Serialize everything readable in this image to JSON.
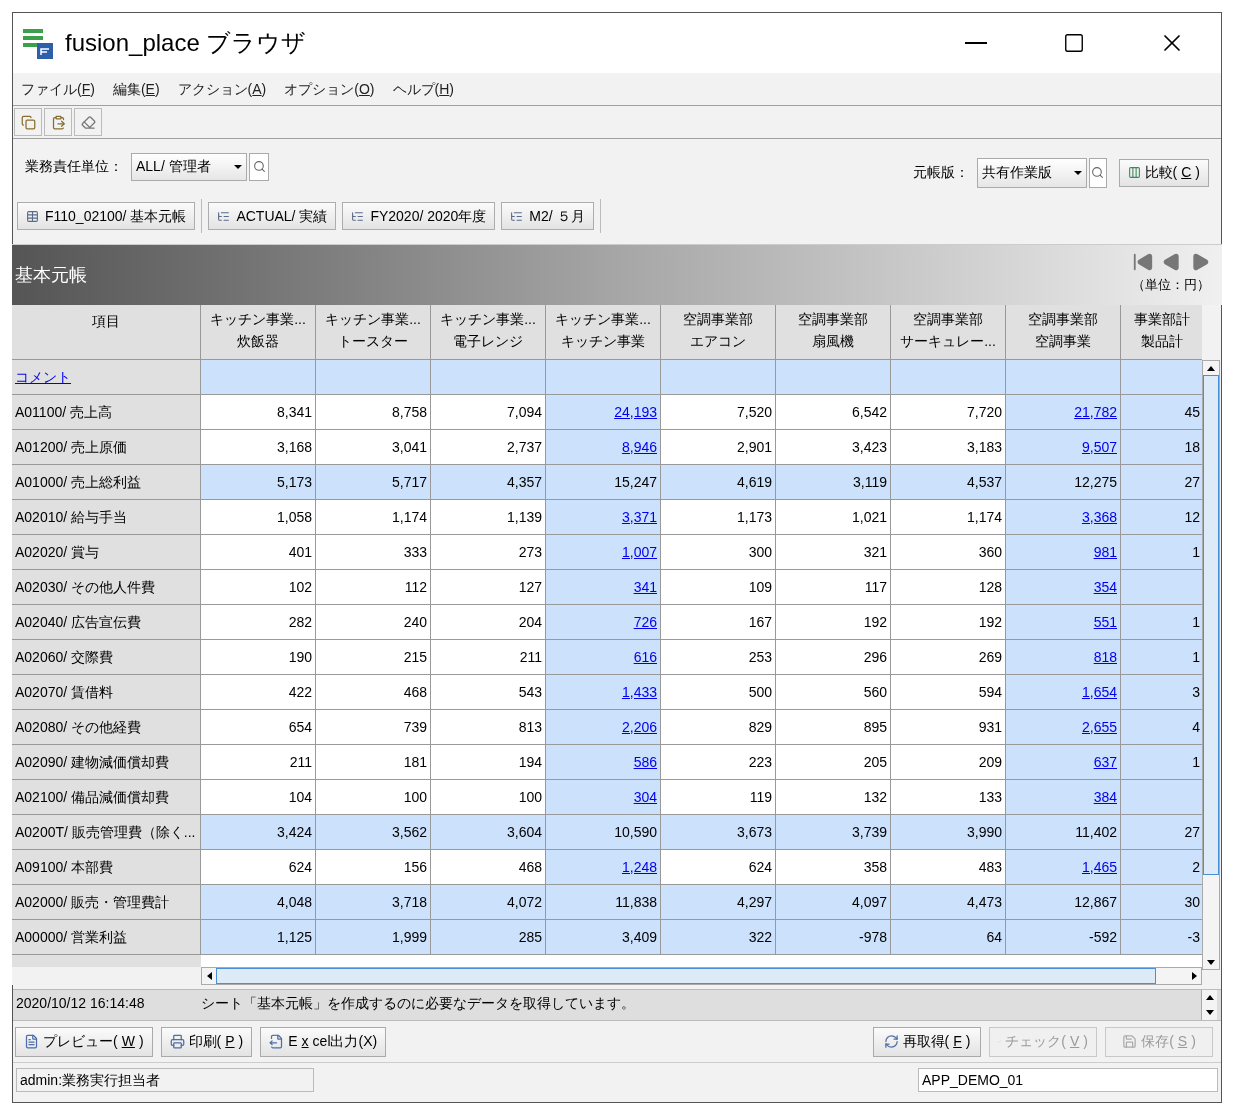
{
  "window": {
    "title": "fusion_place ブラウザ"
  },
  "menu": [
    {
      "before": "ファイル(",
      "key": "F",
      "after": ")"
    },
    {
      "before": "編集(",
      "key": "E",
      "after": ")"
    },
    {
      "before": "アクション(",
      "key": "A",
      "after": ")"
    },
    {
      "before": "オプション(",
      "key": "O",
      "after": ")"
    },
    {
      "before": "ヘルプ(",
      "key": "H",
      "after": ")"
    }
  ],
  "filters": {
    "unit": {
      "label": "業務責任単位：",
      "value": "ALL/ 管理者"
    },
    "version": {
      "label": "元帳版：",
      "value": "共有作業版"
    },
    "compare": {
      "before": "比較(",
      "key": "C",
      "after": ")"
    }
  },
  "chips": [
    {
      "kind": "sheet",
      "label": "F110_02100/ 基本元帳"
    },
    {
      "kind": "dimension",
      "label": "ACTUAL/ 実績"
    },
    {
      "kind": "dimension",
      "label": "FY2020/ 2020年度"
    },
    {
      "kind": "dimension",
      "label": "M2/ ５月"
    }
  ],
  "sheet": {
    "title": "基本元帳",
    "unit": "（単位：円）"
  },
  "table": {
    "corner": "項目",
    "comment": "コメント",
    "columns": [
      {
        "line1": "キッチン事業...",
        "line2": "炊飯器",
        "kind": "item"
      },
      {
        "line1": "キッチン事業...",
        "line2": "トースター",
        "kind": "item"
      },
      {
        "line1": "キッチン事業...",
        "line2": "電子レンジ",
        "kind": "item"
      },
      {
        "line1": "キッチン事業...",
        "line2": "キッチン事業",
        "kind": "subtotal"
      },
      {
        "line1": "空調事業部",
        "line2": "エアコン",
        "kind": "item"
      },
      {
        "line1": "空調事業部",
        "line2": "扇風機",
        "kind": "item"
      },
      {
        "line1": "空調事業部",
        "line2": "サーキュレー...",
        "kind": "item"
      },
      {
        "line1": "空調事業部",
        "line2": "空調事業",
        "kind": "subtotal"
      },
      {
        "line1": "事業部計",
        "line2": "製品計",
        "kind": "total"
      }
    ],
    "rows": [
      {
        "label": "A01100/ 売上高",
        "kind": "detail",
        "cells": [
          "8,341",
          "8,758",
          "7,094",
          "24,193",
          "7,520",
          "6,542",
          "7,720",
          "21,782",
          "45"
        ]
      },
      {
        "label": "A01200/ 売上原価",
        "kind": "detail",
        "cells": [
          "3,168",
          "3,041",
          "2,737",
          "8,946",
          "2,901",
          "3,423",
          "3,183",
          "9,507",
          "18"
        ]
      },
      {
        "label": "A01000/ 売上総利益",
        "kind": "total",
        "cells": [
          "5,173",
          "5,717",
          "4,357",
          "15,247",
          "4,619",
          "3,119",
          "4,537",
          "12,275",
          "27"
        ]
      },
      {
        "label": "A02010/ 給与手当",
        "kind": "detail",
        "cells": [
          "1,058",
          "1,174",
          "1,139",
          "3,371",
          "1,173",
          "1,021",
          "1,174",
          "3,368",
          "12"
        ]
      },
      {
        "label": "A02020/ 賞与",
        "kind": "detail",
        "cells": [
          "401",
          "333",
          "273",
          "1,007",
          "300",
          "321",
          "360",
          "981",
          "1"
        ]
      },
      {
        "label": "A02030/ その他人件費",
        "kind": "detail",
        "cells": [
          "102",
          "112",
          "127",
          "341",
          "109",
          "117",
          "128",
          "354",
          null
        ]
      },
      {
        "label": "A02040/ 広告宣伝費",
        "kind": "detail",
        "cells": [
          "282",
          "240",
          "204",
          "726",
          "167",
          "192",
          "192",
          "551",
          "1"
        ]
      },
      {
        "label": "A02060/ 交際費",
        "kind": "detail",
        "cells": [
          "190",
          "215",
          "211",
          "616",
          "253",
          "296",
          "269",
          "818",
          "1"
        ]
      },
      {
        "label": "A02070/ 賃借料",
        "kind": "detail",
        "cells": [
          "422",
          "468",
          "543",
          "1,433",
          "500",
          "560",
          "594",
          "1,654",
          "3"
        ]
      },
      {
        "label": "A02080/ その他経費",
        "kind": "detail",
        "cells": [
          "654",
          "739",
          "813",
          "2,206",
          "829",
          "895",
          "931",
          "2,655",
          "4"
        ]
      },
      {
        "label": "A02090/ 建物減価償却費",
        "kind": "detail",
        "cells": [
          "211",
          "181",
          "194",
          "586",
          "223",
          "205",
          "209",
          "637",
          "1"
        ]
      },
      {
        "label": "A02100/ 備品減価償却費",
        "kind": "detail",
        "cells": [
          "104",
          "100",
          "100",
          "304",
          "119",
          "132",
          "133",
          "384",
          null
        ]
      },
      {
        "label": "A0200T/ 販売管理費（除く...",
        "kind": "total",
        "cells": [
          "3,424",
          "3,562",
          "3,604",
          "10,590",
          "3,673",
          "3,739",
          "3,990",
          "11,402",
          "27"
        ]
      },
      {
        "label": "A09100/ 本部費",
        "kind": "detail",
        "cells": [
          "624",
          "156",
          "468",
          "1,248",
          "624",
          "358",
          "483",
          "1,465",
          "2"
        ]
      },
      {
        "label": "A02000/ 販売・管理費計",
        "kind": "total",
        "cells": [
          "4,048",
          "3,718",
          "4,072",
          "11,838",
          "4,297",
          "4,097",
          "4,473",
          "12,867",
          "30"
        ]
      },
      {
        "label": "A00000/ 営業利益",
        "kind": "total",
        "cells": [
          "1,125",
          "1,999",
          "285",
          "3,409",
          "322",
          "-978",
          "64",
          "-592",
          "-3"
        ]
      }
    ]
  },
  "log": [
    {
      "time": "2020/10/12 16:14:48",
      "message": "シート「基本元帳」を作成するのに必要なデータを取得しています。"
    }
  ],
  "actions": [
    {
      "before": "プレビュー(",
      "key": "W",
      "after": ")",
      "disabled": false
    },
    {
      "before": "印刷(",
      "key": "P",
      "after": ")",
      "disabled": false
    },
    {
      "before": "E",
      "key": "x",
      "after": "cel出力(X)",
      "disabled": false
    },
    {
      "before": "再取得(",
      "key": "F",
      "after": ")",
      "disabled": false
    },
    {
      "before": "チェック(",
      "key": "V",
      "after": ")",
      "disabled": true
    },
    {
      "before": "保存(",
      "key": "S",
      "after": ")",
      "disabled": true
    }
  ],
  "status_bar": {
    "user": "admin:業務実行担当者",
    "app": "APP_DEMO_01"
  }
}
